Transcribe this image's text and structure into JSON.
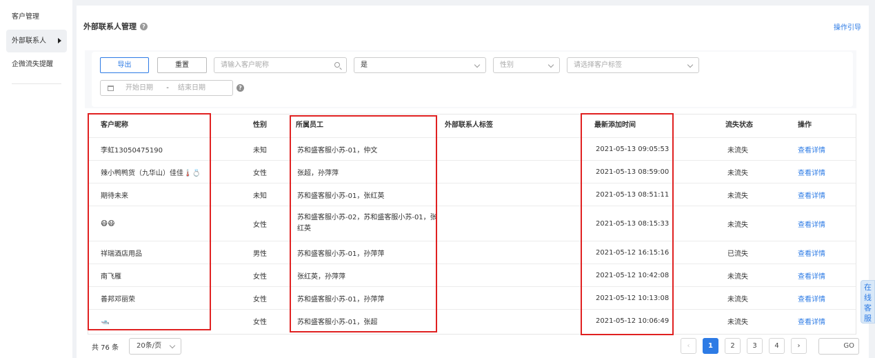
{
  "sidebar": {
    "items": [
      {
        "label": "客户管理"
      },
      {
        "label": "外部联系人"
      },
      {
        "label": "企微流失提醒"
      }
    ]
  },
  "header": {
    "title": "外部联系人管理",
    "help_glyph": "?",
    "guide_link": "操作引导"
  },
  "filters": {
    "export_label": "导出",
    "reset_label": "重置",
    "search_placeholder": "请输入客户昵称",
    "select_yes_value": "是",
    "gender_placeholder": "性别",
    "tag_placeholder": "请选择客户标签",
    "date_start_placeholder": "开始日期",
    "date_separator": "-",
    "date_end_placeholder": "结束日期",
    "help_glyph": "?"
  },
  "table": {
    "columns": [
      "客户昵称",
      "性别",
      "所属员工",
      "外部联系人标签",
      "最新添加时间",
      "流失状态",
      "操作"
    ],
    "rows": [
      {
        "nickname": "李虹13050475190",
        "gender": "未知",
        "staff": "苏和盛客服小苏-01，仲文",
        "tags": "",
        "time": "2021-05-13 09:05:53",
        "status": "未流失",
        "action": "查看详情"
      },
      {
        "nickname": "辣小鸭鸭货（九华山）佳佳🌡️💍",
        "gender": "女性",
        "staff": "张超，孙萍萍",
        "tags": "",
        "time": "2021-05-13 08:59:00",
        "status": "未流失",
        "action": "查看详情"
      },
      {
        "nickname": "期待未来",
        "gender": "未知",
        "staff": "苏和盛客服小苏-01，张红英",
        "tags": "",
        "time": "2021-05-13 08:51:11",
        "status": "未流失",
        "action": "查看详情"
      },
      {
        "nickname": "😷😷",
        "gender": "女性",
        "staff": "苏和盛客服小苏-02，苏和盛客服小苏-01，张红英",
        "tags": "",
        "time": "2021-05-13 08:15:33",
        "status": "未流失",
        "action": "查看详情"
      },
      {
        "nickname": "祥瑞酒店用品",
        "gender": "男性",
        "staff": "苏和盛客服小苏-01，孙萍萍",
        "tags": "",
        "time": "2021-05-12 16:15:16",
        "status": "已流失",
        "action": "查看详情"
      },
      {
        "nickname": "南飞雁",
        "gender": "女性",
        "staff": "张红英，孙萍萍",
        "tags": "",
        "time": "2021-05-12 10:42:08",
        "status": "未流失",
        "action": "查看详情"
      },
      {
        "nickname": "善邦邓丽荣",
        "gender": "女性",
        "staff": "苏和盛客服小苏-01，孙萍萍",
        "tags": "",
        "time": "2021-05-12 10:13:08",
        "status": "未流失",
        "action": "查看详情"
      },
      {
        "nickname": "🛥️",
        "gender": "女性",
        "staff": "苏和盛客服小苏-01，张超",
        "tags": "",
        "time": "2021-05-12 10:06:49",
        "status": "未流失",
        "action": "查看详情"
      }
    ]
  },
  "pagination": {
    "total_label": "共 76 条",
    "page_size": "20条/页",
    "prev_glyph": "‹",
    "next_glyph": "›",
    "pages": [
      "1",
      "2",
      "3",
      "4"
    ],
    "current_page": "1",
    "goto_label": "GO"
  },
  "chat_tab": {
    "label": "在线客服"
  },
  "colors": {
    "accent": "#2d7be5",
    "annotation": "#e02020"
  }
}
